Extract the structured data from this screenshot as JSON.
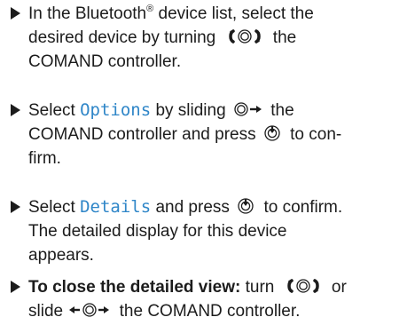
{
  "steps": [
    {
      "lines": [
        {
          "parts": [
            "In the Bluetooth",
            "®",
            " device list, select the"
          ]
        },
        {
          "parts": [
            "desired device by turning ",
            "",
            " the"
          ]
        },
        {
          "parts": [
            "COMAND controller."
          ]
        }
      ]
    },
    {
      "lines": [
        {
          "parts": [
            "Select ",
            "Options",
            " by sliding ",
            "",
            " the"
          ]
        },
        {
          "parts": [
            "COMAND controller and press ",
            "",
            " to con-"
          ]
        },
        {
          "parts": [
            "firm."
          ]
        }
      ]
    },
    {
      "lines": [
        {
          "parts": [
            "Select ",
            "Details",
            " and press ",
            "",
            " to confirm."
          ]
        },
        {
          "parts": [
            "The detailed display for this device"
          ]
        },
        {
          "parts": [
            "appears."
          ]
        }
      ]
    },
    {
      "lines": [
        {
          "parts": [
            "To close the detailed view:",
            " turn ",
            "",
            " or"
          ]
        },
        {
          "parts": [
            "slide ",
            "",
            " the COMAND controller."
          ]
        }
      ]
    }
  ],
  "icons": {
    "turn": "controller-turn-icon",
    "slide_right": "controller-slide-right-icon",
    "press": "controller-press-icon",
    "slide_left_right": "controller-slide-left-right-icon"
  },
  "colors": {
    "ui_term": "#2f86c8",
    "text": "#1c1c1c"
  }
}
